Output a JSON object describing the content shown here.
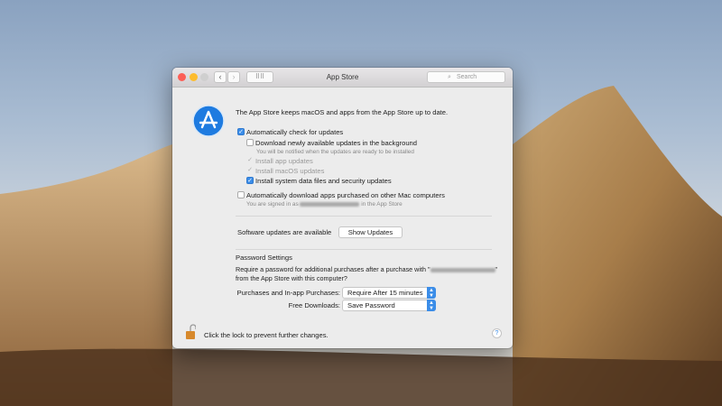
{
  "window": {
    "title": "App Store",
    "search_placeholder": "Search"
  },
  "main": {
    "description": "The App Store keeps macOS and apps from the App Store up to date.",
    "auto_check": {
      "label": "Automatically check for updates",
      "checked": true
    },
    "download_bg": {
      "label": "Download newly available updates in the background",
      "checked": false,
      "note": "You will be notified when the updates are ready to be installed"
    },
    "install_app": {
      "label": "Install app updates",
      "checked": true
    },
    "install_macos": {
      "label": "Install macOS updates",
      "checked": true
    },
    "install_system": {
      "label": "Install system data files and security updates",
      "checked": true
    },
    "auto_download": {
      "label": "Automatically download apps purchased on other Mac computers",
      "checked": false,
      "note_prefix": "You are signed in as",
      "note_suffix": "in the App Store"
    },
    "updates_status": "Software updates are available",
    "show_updates": "Show Updates",
    "password_heading": "Password Settings",
    "password_question_1": "Require a password for additional purchases after a purchase with \"",
    "password_question_end": "\"",
    "password_question_2": "from the App Store with this computer?",
    "purchases_label": "Purchases and In-app Purchases:",
    "purchases_value": "Require After 15 minutes",
    "free_label": "Free Downloads:",
    "free_value": "Save Password"
  },
  "footer": {
    "lock_text": "Click the lock to prevent further changes.",
    "help": "?"
  },
  "colors": {
    "accent": "#3b8de8"
  }
}
